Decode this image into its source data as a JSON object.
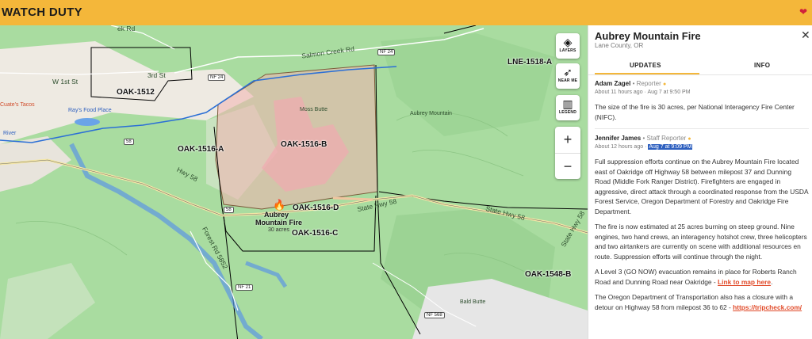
{
  "brand": {
    "name": "WATCH DUTY"
  },
  "map": {
    "controls": {
      "layers": "LAYERS",
      "near_me": "NEAR ME",
      "legend": "LEGEND",
      "zoom_in": "+",
      "zoom_out": "−"
    },
    "zones": [
      {
        "id": "z1",
        "label": "OAK-1512"
      },
      {
        "id": "z2",
        "label": "OAK-1516-A"
      },
      {
        "id": "z3",
        "label": "OAK-1516-B"
      },
      {
        "id": "z4",
        "label": "OAK-1516-D"
      },
      {
        "id": "z5",
        "label": "OAK-1516-C"
      },
      {
        "id": "z6",
        "label": "LNE-1518-A"
      },
      {
        "id": "z7",
        "label": "OAK-1548-B"
      }
    ],
    "fire": {
      "name_line1": "Aubrey",
      "name_line2": "Mountain Fire",
      "size": "30 acres"
    },
    "roads": {
      "salmon_creek": "Salmon Creek Rd",
      "w1st": "W 1st St",
      "third": "3rd St",
      "hwy58": "Hwy 58",
      "state_hwy58_a": "State Hwy 58",
      "state_hwy58_b": "State Hwy 58",
      "state_hwy58_c": "State Hwy 58",
      "forest_rd": "Forest Rd 5852",
      "rays": "Ray's Food Place",
      "river": "River",
      "ck_rd": "ek Rd",
      "shield_nf24": "NF 24",
      "shield_nf24b": "NF 24",
      "shield_58": "58",
      "shield_58b": "58",
      "shield_nf21": "NF 21",
      "shield_nf568": "NF 568",
      "bald_butte": "Bald Butte",
      "moss_butte": "Moss Butte",
      "aubrey_mountain": "Aubrey Mountain",
      "tacos": "Cuate's Tacos"
    }
  },
  "panel": {
    "title": "Aubrey Mountain Fire",
    "location": "Lane County, OR",
    "close": "✕",
    "tabs": [
      {
        "label": "UPDATES"
      },
      {
        "label": "INFO"
      }
    ],
    "entries": [
      {
        "author": "Adam Zagel",
        "role": "Reporter",
        "rel_time": "About 11 hours ago",
        "abs_time": "Aug 7 at 9:50 PM",
        "paragraphs": [
          "The size of the fire is 30 acres, per National Interagency Fire Center (NIFC)."
        ]
      },
      {
        "author": "Jennifer James",
        "role": "Staff Reporter",
        "rel_time": "About 12 hours ago",
        "abs_time": "Aug 7 at 9:09 PM",
        "paragraphs": [
          "Full suppression efforts continue on the Aubrey Mountain Fire located east of Oakridge off Highway 58 between milepost 37 and Dunning Road (Middle Fork Ranger District). Firefighters are engaged in aggressive, direct attack through a coordinated response from the USDA Forest Service, Oregon Department of Forestry and Oakridge Fire Department.",
          "The fire is now estimated at 25 acres burning on steep ground. Nine engines, two hand crews, an interagency hotshot crew, three helicopters and two airtankers are currently on scene with additional resources en route. Suppression efforts will continue through the night."
        ],
        "para3_text": "A Level 3 (GO NOW) evacuation remains in place for Roberts Ranch Road and Dunning Road near Oakridge - ",
        "para3_link": "Link to map here",
        "para3_end": ".",
        "para4_text": "The Oregon Department of Transportation also has a closure with a detour on Highway 58 from milepost 36 to 62 - ",
        "para4_link": "https://tripcheck.com/"
      }
    ]
  },
  "colors": {
    "brand": "#f4b73a",
    "fire_fill": "#f2b2b0",
    "zone_border": "#000000",
    "river": "#2b6fd6"
  }
}
